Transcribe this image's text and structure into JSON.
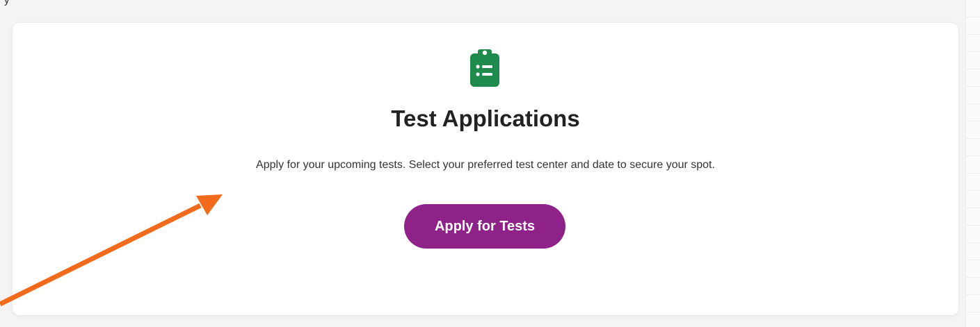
{
  "page": {
    "top_partial_text": "y",
    "background_color": "#f4f4f5"
  },
  "card": {
    "icon": "clipboard-list-icon",
    "icon_color": "#1e8a4c",
    "title": "Test Applications",
    "description": "Apply for your upcoming tests. Select your preferred test center and date to secure your spot.",
    "button_label": "Apply for Tests",
    "button_color": "#8e2288"
  },
  "annotation": {
    "type": "arrow",
    "color": "#f26a1b"
  }
}
